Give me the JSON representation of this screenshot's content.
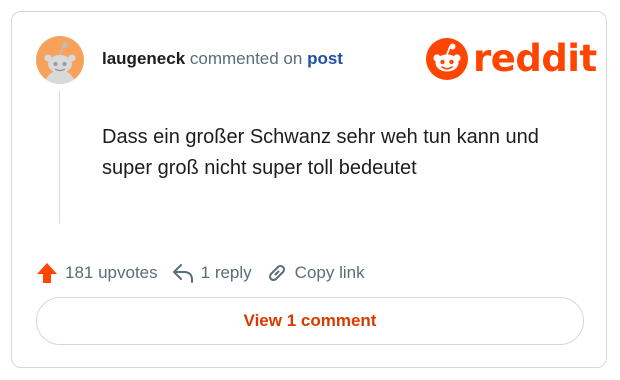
{
  "comment": {
    "author": "laugeneck",
    "action_text": "commented on",
    "post_link": "post",
    "body": "Dass ein großer Schwanz sehr weh tun kann und super groß nicht super toll bedeutet"
  },
  "brand": {
    "logo_text": "reddit",
    "color": "#ff4500",
    "icon": "reddit-snoo-icon"
  },
  "actions": {
    "upvotes_label": "181 upvotes",
    "reply_label": "1 reply",
    "copy_label": "Copy link",
    "icons": [
      "upvote-arrow-icon",
      "reply-icon",
      "link-icon"
    ]
  },
  "view_button": {
    "label": "View 1 comment"
  },
  "colors": {
    "accent": "#ff4500",
    "post_link": "#1f4ea8",
    "muted_text": "#576f76",
    "avatar_bg": "#f6a25a"
  }
}
